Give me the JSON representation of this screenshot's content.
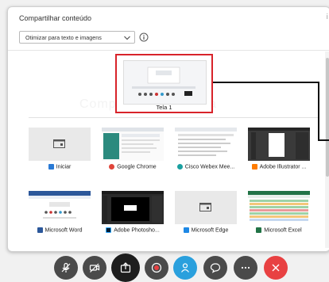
{
  "dialog": {
    "title": "Compartilhar conteúdo",
    "close_glyph": "ⅰ",
    "optimize_select": {
      "value": "Otimizar para texto e imagens",
      "icon": "chevron-down-icon"
    },
    "info_icon": "info-icon"
  },
  "screens": [
    {
      "label": "Tela 1",
      "selected": true
    }
  ],
  "ghost_text": "Compartilhar sua tela",
  "apps": [
    {
      "label": "Iniciar",
      "icon_color": "#2a7ad5"
    },
    {
      "label": "Google Chrome",
      "icon_color": "#e0453a"
    },
    {
      "label": "Cisco Webex Mee...",
      "icon_color": "#1aa0a0"
    },
    {
      "label": "Adobe Illustrator ...",
      "icon_color": "#ff7c00"
    },
    {
      "label": "Microsoft Word",
      "icon_color": "#2b579a"
    },
    {
      "label": "Adobe Photosho...",
      "icon_color": "#31a8ff"
    },
    {
      "label": "Microsoft Edge",
      "icon_color": "#1e88e5"
    },
    {
      "label": "Microsoft Excel",
      "icon_color": "#217346"
    }
  ],
  "toolbar": {
    "buttons": [
      {
        "name": "mute-button",
        "icon": "microphone-off-icon",
        "color": "#4a4a4a"
      },
      {
        "name": "video-button",
        "icon": "camera-off-icon",
        "color": "#4a4a4a"
      },
      {
        "name": "share-button",
        "icon": "share-icon",
        "color": "#1e1e1e"
      },
      {
        "name": "record-button",
        "icon": "record-icon",
        "color": "#4a4a4a"
      },
      {
        "name": "participants-button",
        "icon": "participants-icon",
        "color": "#2aa0dd"
      },
      {
        "name": "chat-button",
        "icon": "chat-icon",
        "color": "#4a4a4a"
      },
      {
        "name": "more-button",
        "icon": "more-icon",
        "color": "#4a4a4a"
      },
      {
        "name": "leave-button",
        "icon": "close-icon",
        "color": "#e84142"
      }
    ]
  }
}
